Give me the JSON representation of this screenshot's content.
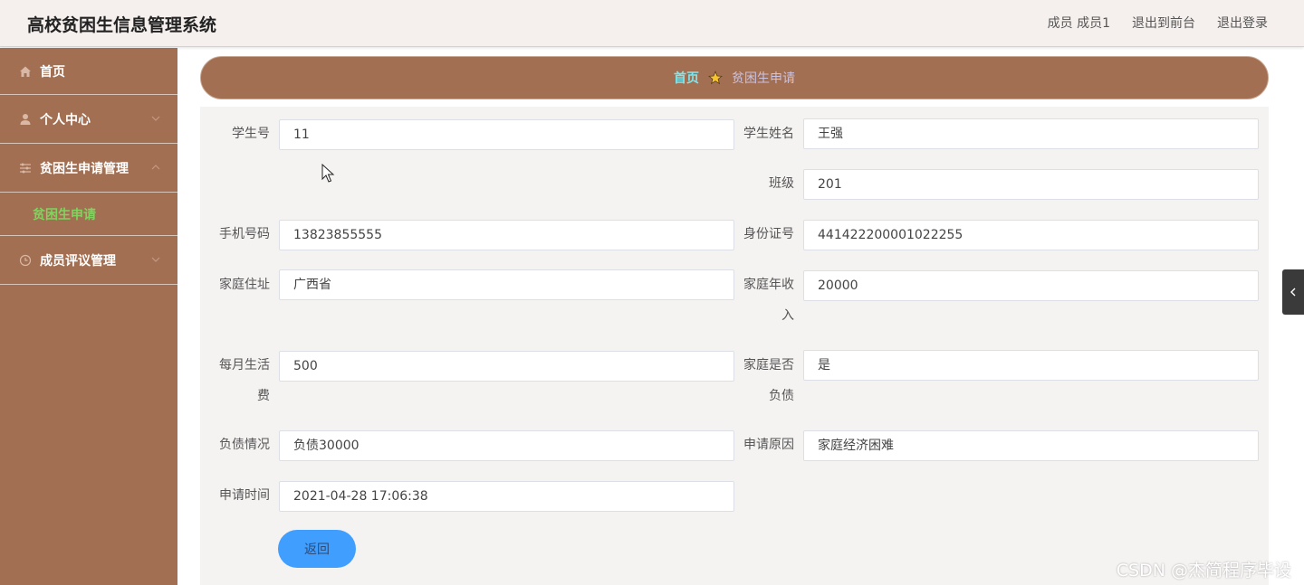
{
  "header": {
    "title": "高校贫困生信息管理系统",
    "links": [
      "成员 成员1",
      "退出到前台",
      "退出登录"
    ]
  },
  "sidebar": {
    "items": [
      {
        "label": "首页",
        "icon": "home-icon"
      },
      {
        "label": "个人中心",
        "icon": "user-icon"
      },
      {
        "label": "贫困生申请管理",
        "icon": "sliders-icon"
      },
      {
        "label": "成员评议管理",
        "icon": "clock-icon"
      }
    ],
    "sub_item": "贫困生申请"
  },
  "breadcrumb": {
    "home": "首页",
    "current": "贫困生申请"
  },
  "form": {
    "student_no": {
      "label": "学生号",
      "value": "11"
    },
    "student_name": {
      "label": "学生姓名",
      "value": "王强"
    },
    "class": {
      "label": "班级",
      "value": "201"
    },
    "phone": {
      "label": "手机号码",
      "value": "13823855555"
    },
    "id_card": {
      "label": "身份证号",
      "value": "441422200001022255"
    },
    "address": {
      "label": "家庭住址",
      "value": "广西省"
    },
    "income_label_1": "家庭年收",
    "income_label_2": "入",
    "income_value": "20000",
    "living_label_1": "每月生活",
    "living_label_2": "费",
    "living_value": "500",
    "debt_label_1": "家庭是否",
    "debt_label_2": "负债",
    "debt_value": "是",
    "debt_detail": {
      "label": "负债情况",
      "value": "负债30000"
    },
    "reason": {
      "label": "申请原因",
      "value": "家庭经济困难"
    },
    "apply_time": {
      "label": "申请时间",
      "value": "2021-04-28 17:06:38"
    },
    "back_label": "返回"
  },
  "watermark": "CSDN @杰简程序毕设",
  "colors": {
    "sidebar_bg": "#a26f52",
    "breadcrumb_home": "#7ee7ee",
    "sub_item": "#7fd35e",
    "button": "#409eff"
  }
}
